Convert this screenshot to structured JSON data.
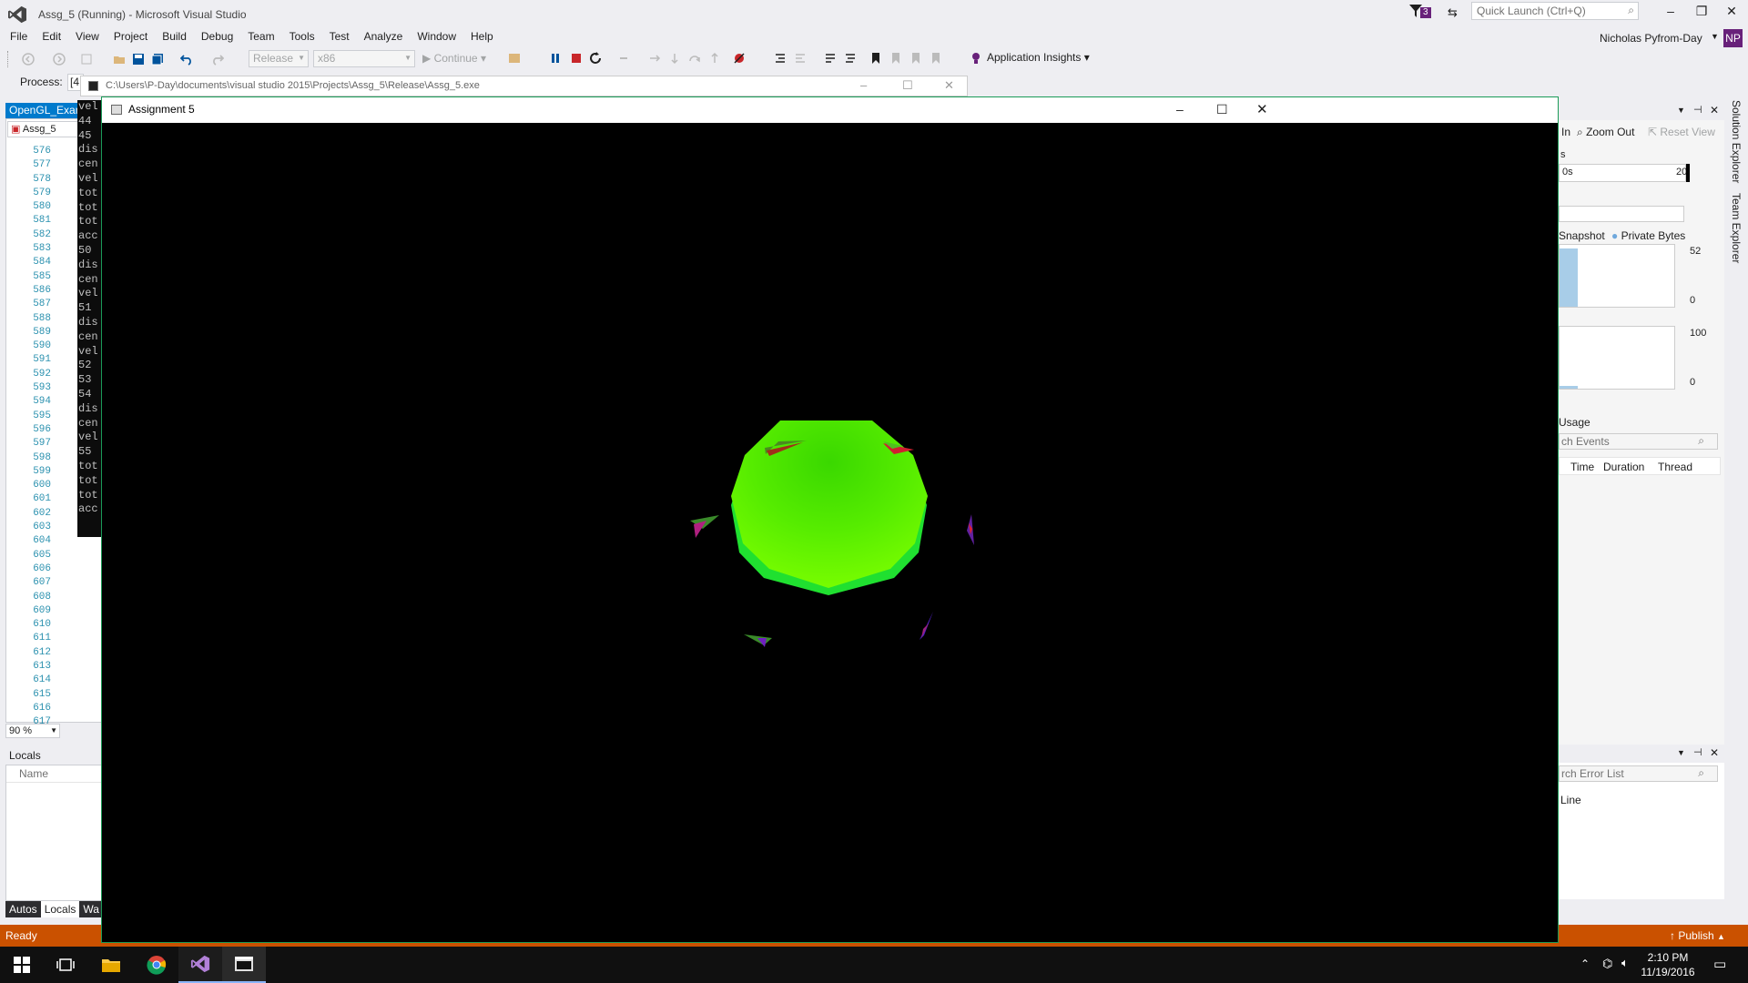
{
  "vs": {
    "title": "Assg_5 (Running) - Microsoft Visual Studio",
    "quick_launch_placeholder": "Quick Launch (Ctrl+Q)",
    "notif_count": "3",
    "user_name": "Nicholas Pyfrom-Day",
    "user_initials": "NP",
    "menu": [
      "File",
      "Edit",
      "View",
      "Project",
      "Build",
      "Debug",
      "Team",
      "Tools",
      "Test",
      "Analyze",
      "Window",
      "Help"
    ],
    "toolbar": {
      "config": "Release",
      "platform": "x86",
      "continue": "Continue",
      "app_insights": "Application Insights"
    },
    "process_label": "Process:",
    "process_value": "[4",
    "doc_tab": "OpenGL_Exam",
    "project_combo": "Assg_5",
    "line_numbers": [
      "576",
      "577",
      "578",
      "579",
      "580",
      "581",
      "582",
      "583",
      "584",
      "585",
      "586",
      "587",
      "588",
      "589",
      "590",
      "591",
      "592",
      "593",
      "594",
      "595",
      "596",
      "597",
      "598",
      "599",
      "600",
      "601",
      "602",
      "603",
      "604",
      "605",
      "606",
      "607",
      "608",
      "609",
      "610",
      "611",
      "612",
      "613",
      "614",
      "615",
      "616",
      "617"
    ],
    "zoom": "90 %",
    "locals_title": "Locals",
    "locals_col_name": "Name",
    "bottom_tabs": [
      "Autos",
      "Locals",
      "Wa"
    ],
    "status": "Ready",
    "publish": "Publish"
  },
  "console": {
    "path": "C:\\Users\\P-Day\\documents\\visual studio 2015\\Projects\\Assg_5\\Release\\Assg_5.exe",
    "lines": [
      "vel",
      "44",
      "45",
      "dis",
      "cen",
      "vel",
      "tot",
      "tot",
      "tot",
      "acc",
      "50",
      "dis",
      "cen",
      "vel",
      "51",
      "dis",
      "cen",
      "vel",
      "52",
      "53",
      "54",
      "dis",
      "cen",
      "vel",
      "55",
      "tot",
      "tot",
      "tot",
      "acc"
    ]
  },
  "diag": {
    "zoom_in": "In",
    "zoom_out": "Zoom Out",
    "reset_view": "Reset View",
    "section_s": "s",
    "timeline_start": "0s",
    "timeline_end": "20",
    "legend_snapshot": "Snapshot",
    "legend_private": "Private Bytes",
    "mem_max": "52",
    "mem_min": "0",
    "cpu_max": "100",
    "cpu_min": "0",
    "usage_title": "Usage",
    "search_events": "ch Events",
    "cols": [
      "Time",
      "Duration",
      "Thread"
    ],
    "error_search": "rch Error List",
    "error_col_line": "Line"
  },
  "side_tabs": [
    "Solution Explorer",
    "Team Explorer"
  ],
  "app": {
    "title": "Assignment 5"
  },
  "taskbar": {
    "time": "2:10 PM",
    "date": "11/19/2016"
  },
  "colors": {
    "vs_purple": "#68217a",
    "status_orange": "#ca5100",
    "accent_blue": "#007acc",
    "sphere_green": "#5ef000"
  }
}
